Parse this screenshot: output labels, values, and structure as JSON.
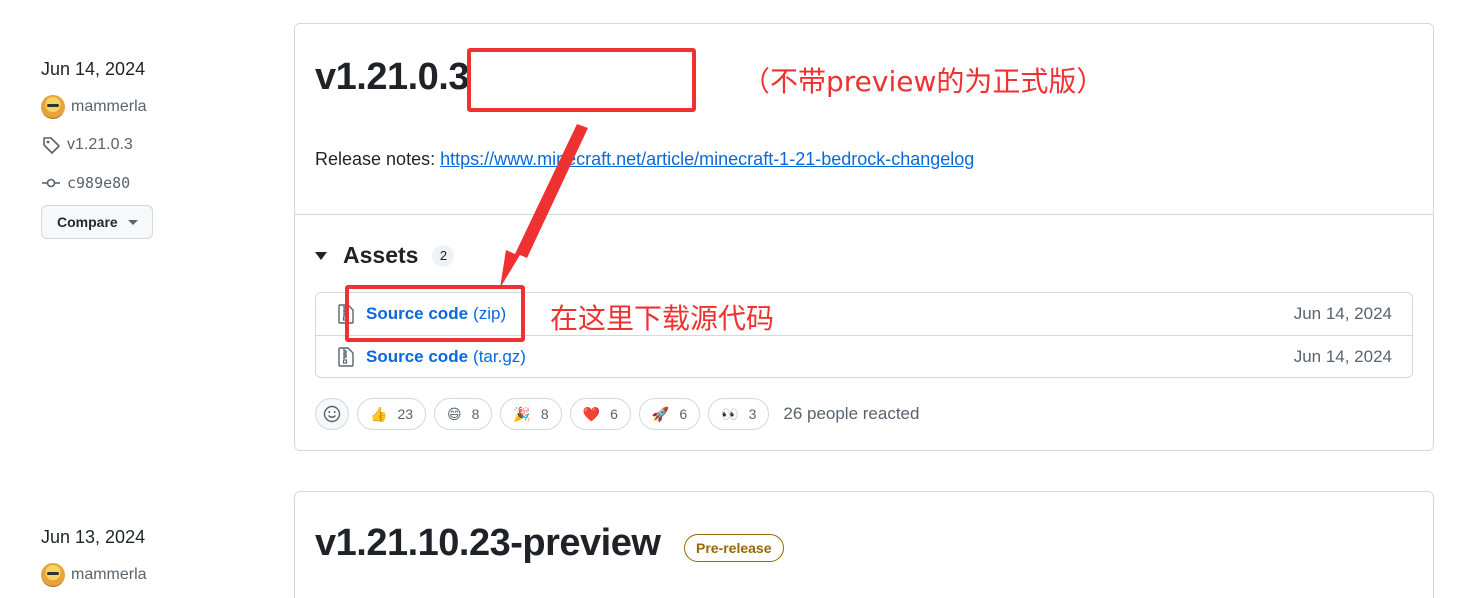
{
  "releases": [
    {
      "date": "Jun 14, 2024",
      "author": "mammerla",
      "tag": "v1.21.0.3",
      "commit": "c989e80",
      "compare_label": "Compare",
      "title": "v1.21.0.3",
      "notes_prefix": "Release notes: ",
      "notes_link": "https://www.minecraft.net/article/minecraft-1-21-bedrock-changelog",
      "assets_label": "Assets",
      "assets_count": "2",
      "assets": [
        {
          "name": "Source code",
          "ext": "(zip)",
          "date": "Jun 14, 2024"
        },
        {
          "name": "Source code",
          "ext": "(tar.gz)",
          "date": "Jun 14, 2024"
        }
      ],
      "reactions": [
        {
          "emoji": "👍",
          "count": "23",
          "icon": "thumbs-up-icon"
        },
        {
          "emoji": "😄",
          "count": "8",
          "icon": "laugh-icon"
        },
        {
          "emoji": "🎉",
          "count": "8",
          "icon": "hooray-icon"
        },
        {
          "emoji": "❤️",
          "count": "6",
          "icon": "heart-icon"
        },
        {
          "emoji": "🚀",
          "count": "6",
          "icon": "rocket-icon"
        },
        {
          "emoji": "👀",
          "count": "3",
          "icon": "eyes-icon"
        }
      ],
      "reactions_summary": "26 people reacted"
    },
    {
      "date": "Jun 13, 2024",
      "author": "mammerla",
      "title": "v1.21.10.23-preview",
      "badge": "Pre-release"
    }
  ],
  "annotations": {
    "note_top": "（不带preview的为正式版）",
    "note_download": "在这里下载源代码",
    "color": "#ee3131"
  },
  "colors": {
    "link": "#0969da",
    "border": "#d1d9e0",
    "muted": "#59636e",
    "prerelease": "#9a6700"
  }
}
